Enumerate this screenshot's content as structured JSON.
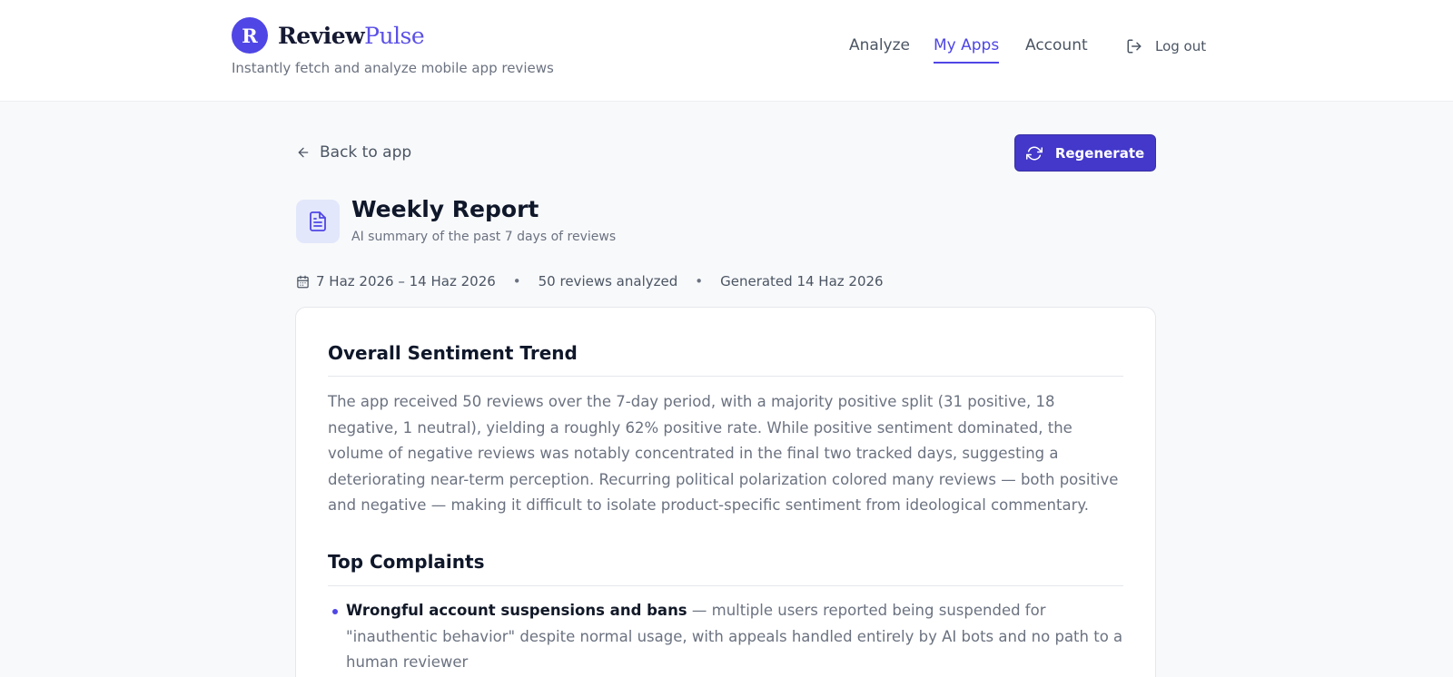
{
  "brand": {
    "logo_letter": "R",
    "name_part1": "Review",
    "name_part2": "Pulse",
    "tagline": "Instantly fetch and analyze mobile app reviews"
  },
  "nav": {
    "analyze": "Analyze",
    "my_apps": "My Apps",
    "account": "Account",
    "logout": "Log out",
    "active": "My Apps"
  },
  "toolbar": {
    "back_label": "Back to app",
    "regenerate_label": "Regenerate"
  },
  "report": {
    "title": "Weekly Report",
    "subtitle": "AI summary of the past 7 days of reviews",
    "date_range": "7 Haz 2026 – 14 Haz 2026",
    "reviews_analyzed": "50 reviews analyzed",
    "generated": "Generated 14 Haz 2026"
  },
  "sections": {
    "sentiment": {
      "title": "Overall Sentiment Trend",
      "body": "The app received 50 reviews over the 7-day period, with a majority positive split (31 positive, 18 negative, 1 neutral), yielding a roughly 62% positive rate. While positive sentiment dominated, the volume of negative reviews was notably concentrated in the final two tracked days, suggesting a deteriorating near-term perception. Recurring political polarization colored many reviews — both positive and negative — making it difficult to isolate product-specific sentiment from ideological commentary."
    },
    "complaints": {
      "title": "Top Complaints",
      "items": [
        {
          "heading": "Wrongful account suspensions and bans",
          "detail": " — multiple users reported being suspended for \"inauthentic behavior\" despite normal usage, with appeals handled entirely by AI bots and no path to a human reviewer"
        }
      ]
    }
  },
  "colors": {
    "accent": "#4f46e5",
    "button": "#4338ca",
    "text_muted": "#6b7280"
  }
}
